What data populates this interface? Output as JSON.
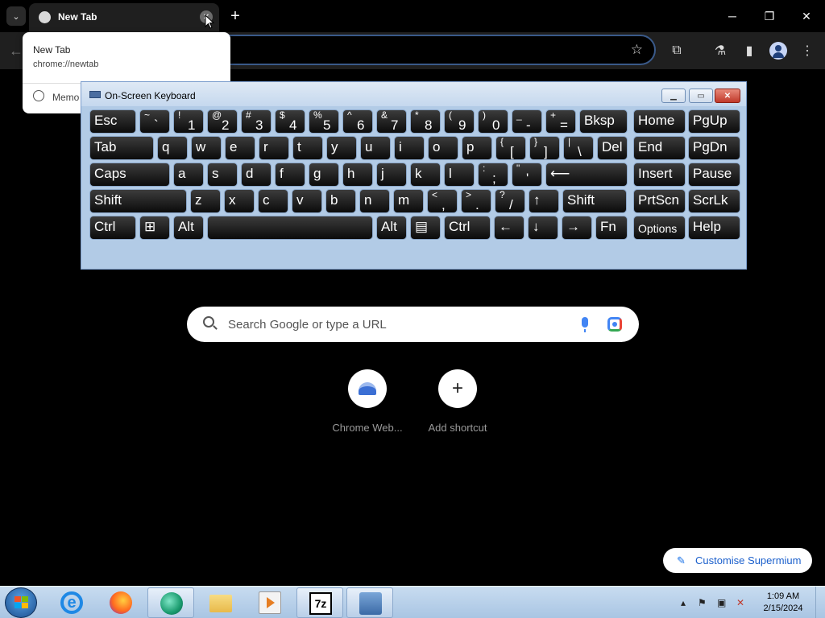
{
  "browser": {
    "tab_title": "New Tab",
    "new_tab_symbol": "+",
    "window_controls": {
      "minimize": "─",
      "restore": "❐",
      "close": "✕"
    },
    "hover_card": {
      "title": "New Tab",
      "url": "chrome://newtab",
      "memory_label": "Memo"
    }
  },
  "osk": {
    "title": "On-Screen Keyboard",
    "keys": [
      {
        "label": "Esc"
      },
      {
        "top": "~",
        "bot": "`"
      },
      {
        "top": "!",
        "bot": "1"
      },
      {
        "top": "@",
        "bot": "2"
      },
      {
        "top": "#",
        "bot": "3"
      },
      {
        "top": "$",
        "bot": "4"
      },
      {
        "top": "%",
        "bot": "5"
      },
      {
        "top": "^",
        "bot": "6"
      },
      {
        "top": "&",
        "bot": "7"
      },
      {
        "top": "*",
        "bot": "8"
      },
      {
        "top": "(",
        "bot": "9"
      },
      {
        "top": ")",
        "bot": "0"
      },
      {
        "top": "_",
        "bot": "-"
      },
      {
        "top": "+",
        "bot": "="
      },
      {
        "label": "Bksp"
      },
      {
        "label": "Home"
      },
      {
        "label": "PgUp"
      },
      {
        "label": "Tab"
      },
      {
        "label": "q"
      },
      {
        "label": "w"
      },
      {
        "label": "e"
      },
      {
        "label": "r"
      },
      {
        "label": "t"
      },
      {
        "label": "y"
      },
      {
        "label": "u"
      },
      {
        "label": "i"
      },
      {
        "label": "o"
      },
      {
        "label": "p"
      },
      {
        "top": "{",
        "bot": "["
      },
      {
        "top": "}",
        "bot": "]"
      },
      {
        "top": "|",
        "bot": "\\"
      },
      {
        "label": "Del"
      },
      {
        "label": "End"
      },
      {
        "label": "PgDn"
      },
      {
        "label": "Caps"
      },
      {
        "label": "a"
      },
      {
        "label": "s"
      },
      {
        "label": "d"
      },
      {
        "label": "f"
      },
      {
        "label": "g"
      },
      {
        "label": "h"
      },
      {
        "label": "j"
      },
      {
        "label": "k"
      },
      {
        "label": "l"
      },
      {
        "top": ":",
        "bot": ";"
      },
      {
        "top": "\"",
        "bot": "'"
      },
      {
        "label": "⟵"
      },
      {
        "label": "Insert"
      },
      {
        "label": "Pause"
      },
      {
        "label": "Shift"
      },
      {
        "label": "z"
      },
      {
        "label": "x"
      },
      {
        "label": "c"
      },
      {
        "label": "v"
      },
      {
        "label": "b"
      },
      {
        "label": "n"
      },
      {
        "label": "m"
      },
      {
        "top": "<",
        "bot": ","
      },
      {
        "top": ">",
        "bot": "."
      },
      {
        "top": "?",
        "bot": "/"
      },
      {
        "label": "↑"
      },
      {
        "label": "Shift"
      },
      {
        "label": "PrtScn"
      },
      {
        "label": "ScrLk"
      },
      {
        "label": "Ctrl"
      },
      {
        "label": "⊞"
      },
      {
        "label": "Alt"
      },
      {
        "label": ""
      },
      {
        "label": "Alt"
      },
      {
        "label": "▤"
      },
      {
        "label": "Ctrl"
      },
      {
        "label": "←"
      },
      {
        "label": "↓"
      },
      {
        "label": "→"
      },
      {
        "label": "Fn"
      },
      {
        "label": "Options"
      },
      {
        "label": "Help"
      }
    ]
  },
  "ntp": {
    "search_placeholder": "Search Google or type a URL",
    "shortcuts": [
      {
        "label": "Chrome Web..."
      },
      {
        "label": "Add shortcut",
        "symbol": "+"
      }
    ],
    "customise_label": "Customise Supermium"
  },
  "taskbar": {
    "ie_letter": "e",
    "zip_label": "7z",
    "time": "1:09 AM",
    "date": "2/15/2024"
  }
}
